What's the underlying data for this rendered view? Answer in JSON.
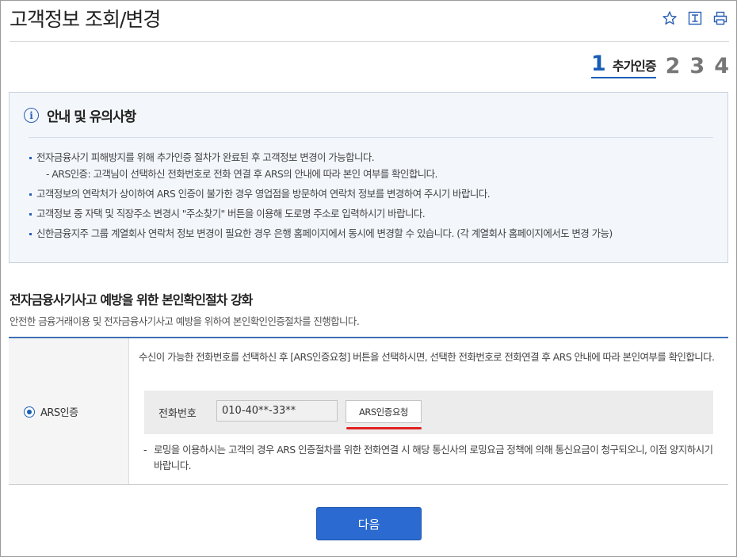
{
  "page": {
    "title": "고객정보 조회/변경"
  },
  "toolbar": {
    "icons": [
      "star-icon",
      "bookmark-icon",
      "print-icon"
    ],
    "accent": "#2b5fb3"
  },
  "steps": {
    "active_number": "1",
    "active_label": "추가인증",
    "others": [
      "2",
      "3",
      "4"
    ]
  },
  "notice": {
    "title": "안내 및 유의사항",
    "items": [
      "전자금융사기 피해방지를 위해 추가인증 절차가 완료된 후 고객정보 변경이 가능합니다.",
      "- ARS인증: 고객님이 선택하신 전화번호로 전화 연결 후 ARS의 안내에 따라 본인 여부를 확인합니다.",
      "고객정보의 연락처가 상이하여 ARS 인증이 불가한 경우 영업점을 방문하여 연락처 정보를 변경하여 주시기 바랍니다.",
      "고객정보 중 자택 및 직장주소 변경시 \"주소찾기\" 버튼을 이용해 도로명 주소로 입력하시기 바랍니다.",
      "신한금융지주 그룹 계열회사 연락처 정보 변경이 필요한 경우 은행 홈페이지에서 동시에 변경할 수 있습니다. (각 계열회사 홈페이지에서도 변경 가능)"
    ]
  },
  "section": {
    "title": "전자금융사기사고 예방을 위한 본인확인절차 강화",
    "desc": "안전한 금융거래이용 및 전자금융사기사고 예방을 위하여 본인확인인증절차를 진행합니다."
  },
  "ars": {
    "radio_label": "ARS인증",
    "radio_selected": true,
    "description": "수신이 가능한 전화번호를 선택하신 후 [ARS인증요청] 버튼을 선택하시면, 선택한 전화번호로 전화연결 후 ARS 안내에 따라 본인여부를 확인합니다.",
    "phone_label": "전화번호",
    "phone_value": "010-40**-33**",
    "request_button": "ARS인증요청",
    "highlight_color": "#e02020",
    "roaming_dash": "-",
    "roaming_note": "로밍을 이용하시는 고객의 경우 ARS 인증절차를 위한 전화연결 시 해당 통신사의 로밍요금 정책에 의해 통신요금이 청구되오니, 이점 양지하시기 바랍니다."
  },
  "footer": {
    "next_button": "다음",
    "next_color": "#2a6ad1"
  }
}
